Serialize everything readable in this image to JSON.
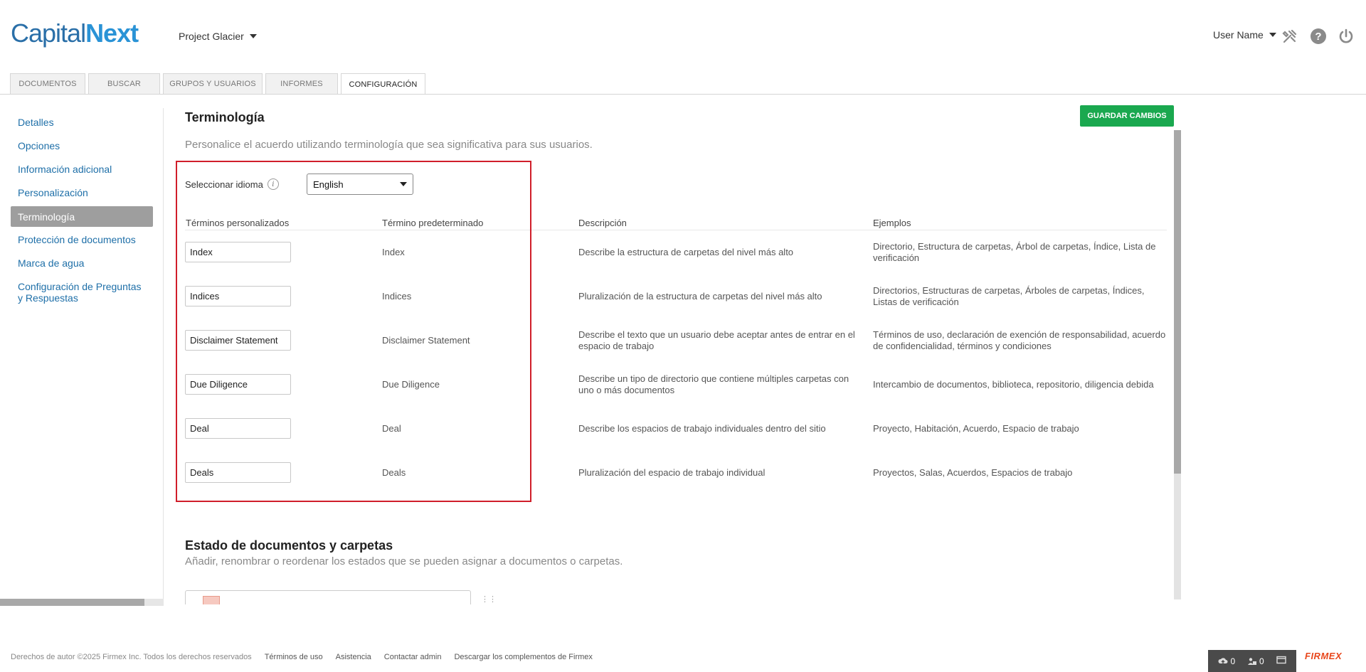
{
  "header": {
    "logo_part1": "Capital",
    "logo_part2": "Next",
    "project": "Project Glacier",
    "user": "User Name",
    "icons": [
      "tools-icon",
      "help-icon",
      "power-icon"
    ]
  },
  "tabs": [
    {
      "label": "DOCUMENTOS"
    },
    {
      "label": "BUSCAR"
    },
    {
      "label": "GRUPOS Y USUARIOS"
    },
    {
      "label": "INFORMES"
    },
    {
      "label": "CONFIGURACIÓN",
      "active": true
    }
  ],
  "sidebar": {
    "items": [
      {
        "label": "Detalles"
      },
      {
        "label": "Opciones"
      },
      {
        "label": "Información adicional"
      },
      {
        "label": "Personalización"
      },
      {
        "label": "Terminología",
        "active": true
      },
      {
        "label": "Protección de documentos"
      },
      {
        "label": "Marca de agua"
      },
      {
        "label": "Configuración de Preguntas y Respuestas"
      }
    ]
  },
  "main": {
    "title": "Terminología",
    "save_button": "GUARDAR CAMBIOS",
    "subtitle": "Personalice el acuerdo utilizando terminología que sea significativa para sus usuarios.",
    "language_label": "Seleccionar idioma",
    "info_glyph": "i",
    "language_value": "English",
    "columns": {
      "custom": "Términos personalizados",
      "default": "Término predeterminado",
      "description": "Descripción",
      "examples": "Ejemplos"
    },
    "rows": [
      {
        "custom": "Index",
        "default": "Index",
        "description": "Describe la estructura de carpetas del nivel más alto",
        "examples": "Directorio, Estructura de carpetas, Árbol de carpetas, Índice, Lista de verificación"
      },
      {
        "custom": "Indices",
        "default": "Indices",
        "description": "Pluralización de la estructura de carpetas del nivel más alto",
        "examples": "Directorios, Estructuras de carpetas, Árboles de carpetas, Índices, Listas de verificación"
      },
      {
        "custom": "Disclaimer Statement",
        "default": "Disclaimer Statement",
        "description": "Describe el texto que un usuario debe aceptar antes de entrar en el espacio de trabajo",
        "examples": "Términos de uso, declaración de exención de responsabilidad, acuerdo de confidencialidad, términos y condiciones"
      },
      {
        "custom": "Due Diligence",
        "default": "Due Diligence",
        "description": "Describe un tipo de directorio que contiene múltiples carpetas con uno o más documentos",
        "examples": "Intercambio de documentos, biblioteca, repositorio, diligencia debida"
      },
      {
        "custom": "Deal",
        "default": "Deal",
        "description": "Describe los espacios de trabajo individuales dentro del sitio",
        "examples": "Proyecto, Habitación, Acuerdo, Espacio de trabajo"
      },
      {
        "custom": "Deals",
        "default": "Deals",
        "description": "Pluralización del espacio de trabajo individual",
        "examples": "Proyectos, Salas, Acuerdos, Espacios de trabajo"
      }
    ],
    "section2_title": "Estado de documentos y carpetas",
    "section2_subtitle": "Añadir, renombrar o reordenar los estados que se pueden asignar a documentos o carpetas."
  },
  "footer": {
    "copyright": "Derechos de autor ©2025 Firmex Inc. Todos los derechos reservados",
    "links": [
      "Términos de uso",
      "Asistencia",
      "Contactar admin",
      "Descargar los complementos de Firmex"
    ],
    "upload_count": "0",
    "users_count": "0",
    "brand": "FIRMEX"
  },
  "colors": {
    "accent_blue": "#1e6fa8",
    "save_green": "#1aa84f",
    "highlight_red": "#d01e2a",
    "firmex_orange": "#e8461b"
  }
}
